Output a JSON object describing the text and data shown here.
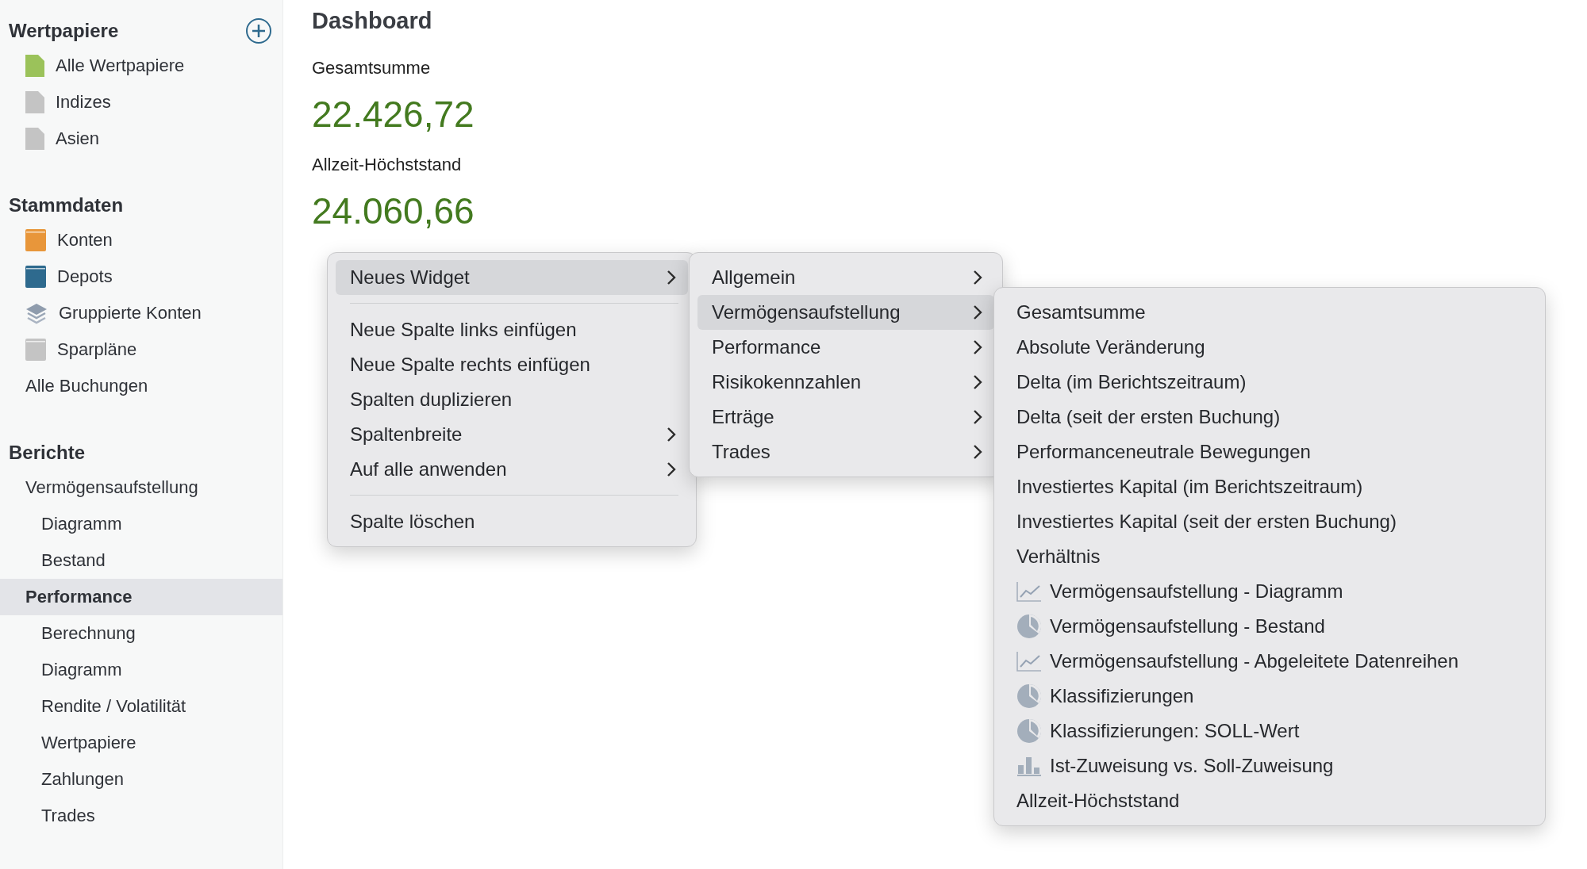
{
  "sidebar": {
    "sections": [
      {
        "title": "Wertpapiere",
        "add_button": true,
        "items": [
          {
            "label": "Alle Wertpapiere",
            "kind": "document",
            "color": "#9bc25a",
            "selected": false
          },
          {
            "label": "Indizes",
            "kind": "document",
            "color": "#c4c4c4",
            "selected": false
          },
          {
            "label": "Asien",
            "kind": "document",
            "color": "#c4c4c4",
            "selected": false
          }
        ]
      },
      {
        "title": "Stammdaten",
        "items": [
          {
            "label": "Konten",
            "kind": "book",
            "color": "#e8963a",
            "selected": false
          },
          {
            "label": "Depots",
            "kind": "book",
            "color": "#2e6a8e",
            "selected": false
          },
          {
            "label": "Gruppierte Konten",
            "kind": "layers",
            "selected": false
          },
          {
            "label": "Sparpläne",
            "kind": "book",
            "color": "#c4c4c4",
            "selected": false
          },
          {
            "label": "Alle Buchungen",
            "kind": "plain",
            "selected": false
          }
        ]
      },
      {
        "title": "Berichte",
        "items": [
          {
            "label": "Vermögensaufstellung",
            "kind": "plain",
            "selected": false,
            "children": [
              {
                "label": "Diagramm",
                "kind": "plain",
                "selected": false
              },
              {
                "label": "Bestand",
                "kind": "plain",
                "selected": false
              }
            ]
          },
          {
            "label": "Performance",
            "kind": "plain",
            "selected": true,
            "children": [
              {
                "label": "Berechnung",
                "kind": "plain",
                "selected": false
              },
              {
                "label": "Diagramm",
                "kind": "plain",
                "selected": false
              },
              {
                "label": "Rendite / Volatilität",
                "kind": "plain",
                "selected": false
              },
              {
                "label": "Wertpapiere",
                "kind": "plain",
                "selected": false
              },
              {
                "label": "Zahlungen",
                "kind": "plain",
                "selected": false
              },
              {
                "label": "Trades",
                "kind": "plain",
                "selected": false
              }
            ]
          }
        ]
      }
    ]
  },
  "dashboard": {
    "title": "Dashboard",
    "widgets": [
      {
        "label": "Gesamtsumme",
        "value": "22.426,72"
      },
      {
        "label": "Allzeit-Höchststand",
        "value": "24.060,66"
      }
    ]
  },
  "context_menu": {
    "groups": [
      [
        {
          "label": "Neues Widget",
          "submenu": true,
          "highlighted": true
        }
      ],
      [
        {
          "label": "Neue Spalte links einfügen",
          "submenu": false,
          "highlighted": false
        },
        {
          "label": "Neue Spalte rechts einfügen",
          "submenu": false,
          "highlighted": false
        },
        {
          "label": "Spalten duplizieren",
          "submenu": false,
          "highlighted": false
        },
        {
          "label": "Spaltenbreite",
          "submenu": true,
          "highlighted": false
        },
        {
          "label": "Auf alle anwenden",
          "submenu": true,
          "highlighted": false
        }
      ],
      [
        {
          "label": "Spalte löschen",
          "submenu": false,
          "highlighted": false
        }
      ]
    ]
  },
  "widget_menu": {
    "items": [
      {
        "label": "Allgemein",
        "submenu": true,
        "highlighted": false
      },
      {
        "label": "Vermögensaufstellung",
        "submenu": true,
        "highlighted": true
      },
      {
        "label": "Performance",
        "submenu": true,
        "highlighted": false
      },
      {
        "label": "Risikokennzahlen",
        "submenu": true,
        "highlighted": false
      },
      {
        "label": "Erträge",
        "submenu": true,
        "highlighted": false
      },
      {
        "label": "Trades",
        "submenu": true,
        "highlighted": false
      }
    ]
  },
  "statement_menu": {
    "items": [
      {
        "label": "Gesamtsumme",
        "kind": "none"
      },
      {
        "label": "Absolute Veränderung",
        "kind": "none"
      },
      {
        "label": "Delta (im Berichtszeitraum)",
        "kind": "none"
      },
      {
        "label": "Delta (seit der ersten Buchung)",
        "kind": "none"
      },
      {
        "label": "Performanceneutrale Bewegungen",
        "kind": "none"
      },
      {
        "label": "Investiertes Kapital (im Berichtszeitraum)",
        "kind": "none"
      },
      {
        "label": "Investiertes Kapital (seit der ersten Buchung)",
        "kind": "none"
      },
      {
        "label": "Verhältnis",
        "kind": "none"
      },
      {
        "label": "Vermögensaufstellung - Diagramm",
        "kind": "line-chart"
      },
      {
        "label": "Vermögensaufstellung - Bestand",
        "kind": "pie-chart"
      },
      {
        "label": "Vermögensaufstellung - Abgeleitete Datenreihen",
        "kind": "line-chart"
      },
      {
        "label": "Klassifizierungen",
        "kind": "pie-chart"
      },
      {
        "label": "Klassifizierungen: SOLL-Wert",
        "kind": "pie-chart"
      },
      {
        "label": "Ist-Zuweisung vs. Soll-Zuweisung",
        "kind": "bar-chart"
      },
      {
        "label": "Allzeit-Höchststand",
        "kind": "none"
      }
    ]
  }
}
